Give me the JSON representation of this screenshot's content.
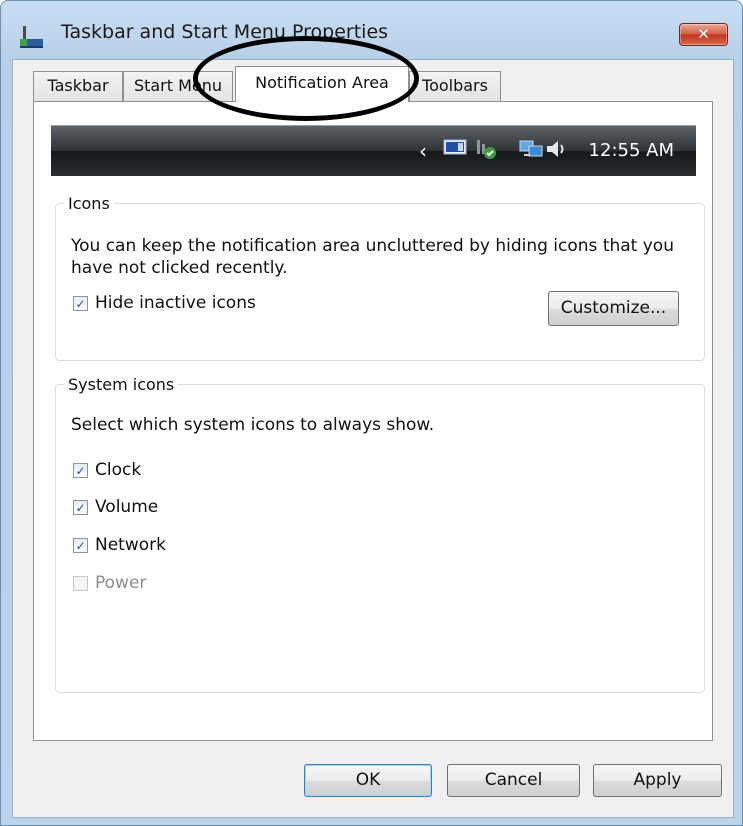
{
  "window": {
    "title": "Taskbar and Start Menu Properties",
    "close_label": "✕"
  },
  "tabs": [
    {
      "label": "Taskbar"
    },
    {
      "label": "Start Menu"
    },
    {
      "label": "Notification Area"
    },
    {
      "label": "Toolbars"
    }
  ],
  "active_tab": "Notification Area",
  "preview": {
    "chevron": "‹",
    "clock": "12:55 AM",
    "icons": [
      "monitor-icon",
      "network-ok-icon",
      "network-icon",
      "speaker-icon"
    ]
  },
  "icons_group": {
    "legend": "Icons",
    "description": "You can keep the notification area uncluttered by hiding icons that you have not clicked recently.",
    "hide_inactive": {
      "label": "Hide inactive icons",
      "checked": true
    },
    "customize_label": "Customize..."
  },
  "system_group": {
    "legend": "System icons",
    "description": "Select which system icons to always show.",
    "items": [
      {
        "label": "Clock",
        "checked": true,
        "enabled": true
      },
      {
        "label": "Volume",
        "checked": true,
        "enabled": true
      },
      {
        "label": "Network",
        "checked": true,
        "enabled": true
      },
      {
        "label": "Power",
        "checked": false,
        "enabled": false
      }
    ]
  },
  "buttons": {
    "ok": "OK",
    "cancel": "Cancel",
    "apply": "Apply"
  },
  "checkmark": "✓",
  "colors": {
    "taskbar": "#2d3236",
    "close": "#c0321b",
    "default_button": "#3c7fb1"
  }
}
